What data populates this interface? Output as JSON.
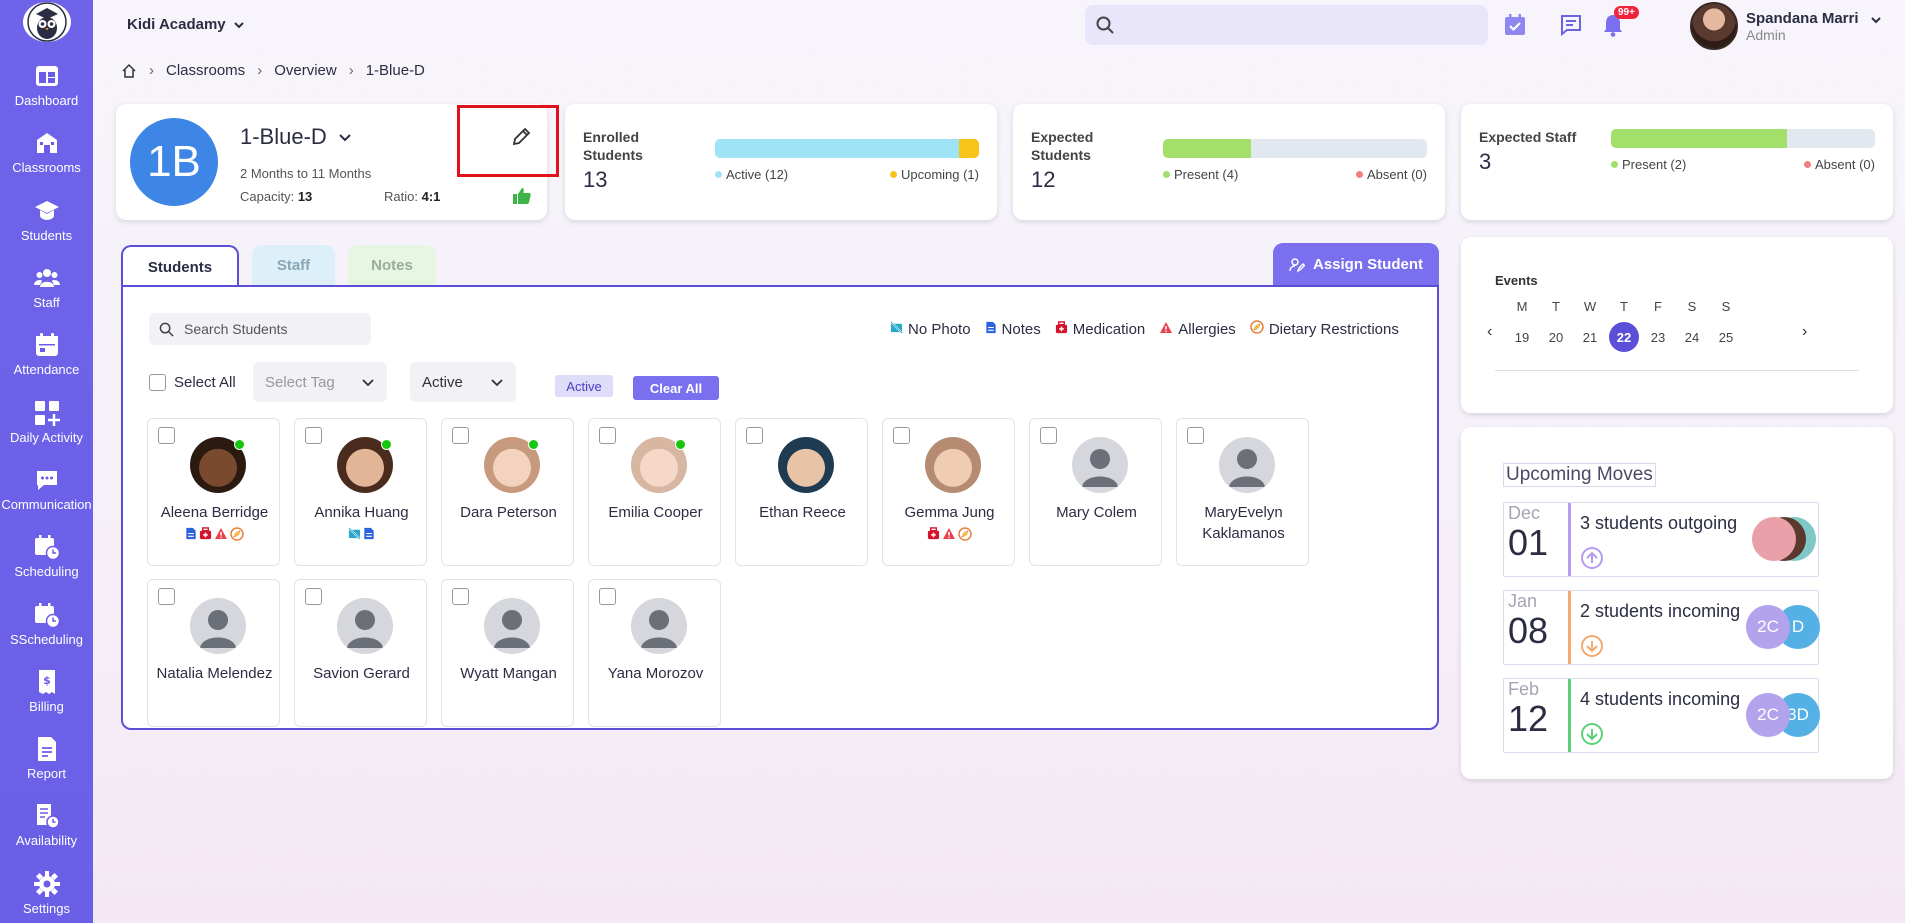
{
  "app": {
    "school_name": "Kidi Acadamy"
  },
  "sidebar": {
    "items": [
      {
        "label": "Dashboard",
        "icon": "dashboard-icon"
      },
      {
        "label": "Classrooms",
        "icon": "classroom-icon"
      },
      {
        "label": "Students",
        "icon": "graduation-cap-icon"
      },
      {
        "label": "Staff",
        "icon": "people-icon"
      },
      {
        "label": "Attendance",
        "icon": "calendar-icon"
      },
      {
        "label": "Daily Activity",
        "icon": "grid-plus-icon"
      },
      {
        "label": "Communication",
        "icon": "chat-icon"
      },
      {
        "label": "Scheduling",
        "icon": "calendar-clock-icon"
      },
      {
        "label": "SScheduling",
        "icon": "calendar-clock-icon"
      },
      {
        "label": "Billing",
        "icon": "invoice-icon"
      },
      {
        "label": "Report",
        "icon": "report-icon"
      },
      {
        "label": "Availability",
        "icon": "availability-icon"
      },
      {
        "label": "Settings",
        "icon": "gear-icon"
      }
    ]
  },
  "header": {
    "search_placeholder": "",
    "notification_count": "99+",
    "user_name": "Spandana Marri",
    "user_role": "Admin"
  },
  "breadcrumb": {
    "items": [
      "Classrooms",
      "Overview",
      "1-Blue-D"
    ]
  },
  "classroom": {
    "initials": "1B",
    "name": "1-Blue-D",
    "age_range": "2 Months to 11 Months",
    "capacity_label": "Capacity:",
    "capacity": "13",
    "ratio_label": "Ratio:",
    "ratio": "4:1"
  },
  "stats": {
    "enrolled": {
      "label": "Enrolled Students",
      "value": "13",
      "active_label": "Active (12)",
      "upcoming_label": "Upcoming (1)",
      "active_fraction": 0.923,
      "upcoming_fraction": 0.077
    },
    "expected_students": {
      "label": "Expected Students",
      "value": "12",
      "present_label": "Present (4)",
      "absent_label": "Absent (0)",
      "present_fraction": 0.333
    },
    "expected_staff": {
      "label": "Expected Staff",
      "value": "3",
      "present_label": "Present (2)",
      "absent_label": "Absent (0)",
      "present_fraction": 0.667
    }
  },
  "tabs": [
    {
      "label": "Students"
    },
    {
      "label": "Staff"
    },
    {
      "label": "Notes"
    }
  ],
  "assign_button": "Assign Student",
  "students_panel": {
    "search_placeholder": "Search Students",
    "keys": [
      "No Photo",
      "Notes",
      "Medication",
      "Allergies",
      "Dietary Restrictions"
    ],
    "select_all": "Select All",
    "tag_placeholder": "Select Tag",
    "status_value": "Active",
    "active_chip": "Active",
    "clear_all": "Clear All",
    "students": [
      {
        "name": "Aleena Berridge",
        "online": true,
        "photo": true,
        "icons": [
          "notes",
          "medication",
          "allergies",
          "dietary"
        ]
      },
      {
        "name": "Annika Huang",
        "online": true,
        "photo": true,
        "icons": [
          "no-photo",
          "notes"
        ]
      },
      {
        "name": "Dara Peterson",
        "online": true,
        "photo": true,
        "icons": []
      },
      {
        "name": "Emilia Cooper",
        "online": true,
        "photo": true,
        "icons": []
      },
      {
        "name": "Ethan Reece",
        "online": false,
        "photo": true,
        "icons": []
      },
      {
        "name": "Gemma Jung",
        "online": false,
        "photo": true,
        "icons": [
          "medication",
          "allergies",
          "dietary"
        ]
      },
      {
        "name": "Mary Colem",
        "online": false,
        "photo": false,
        "icons": []
      },
      {
        "name": "MaryEvelyn Kaklamanos",
        "online": false,
        "photo": false,
        "icons": []
      },
      {
        "name": "Natalia Melendez",
        "online": false,
        "photo": false,
        "icons": []
      },
      {
        "name": "Savion Gerard",
        "online": false,
        "photo": false,
        "icons": []
      },
      {
        "name": "Wyatt Mangan",
        "online": false,
        "photo": false,
        "icons": []
      },
      {
        "name": "Yana Morozov",
        "online": false,
        "photo": false,
        "icons": []
      }
    ]
  },
  "events": {
    "title": "Events",
    "days": [
      {
        "d": "M",
        "n": "19"
      },
      {
        "d": "T",
        "n": "20"
      },
      {
        "d": "W",
        "n": "21"
      },
      {
        "d": "T",
        "n": "22",
        "selected": true
      },
      {
        "d": "F",
        "n": "23"
      },
      {
        "d": "S",
        "n": "24"
      },
      {
        "d": "S",
        "n": "25"
      }
    ]
  },
  "upcoming_moves": {
    "title": "Upcoming Moves",
    "moves": [
      {
        "month": "Dec",
        "day": "01",
        "text": "3 students outgoing",
        "direction": "up",
        "accent": "#b59cf0",
        "avatars": []
      },
      {
        "month": "Jan",
        "day": "08",
        "text": "2 students incoming",
        "direction": "down",
        "accent": "#f5a970",
        "avatars": [
          "2C",
          "D"
        ]
      },
      {
        "month": "Feb",
        "day": "12",
        "text": "4 students incoming",
        "direction": "down",
        "accent": "#5cd07a",
        "avatars": [
          "2C",
          "3D"
        ]
      }
    ]
  },
  "colors": {
    "sidebar": "#6c5ce7",
    "accent": "#5b4fd8",
    "active_bar": "#9fe3f7",
    "upcoming_bar": "#f7c51a",
    "present_bar": "#a3e06b"
  }
}
